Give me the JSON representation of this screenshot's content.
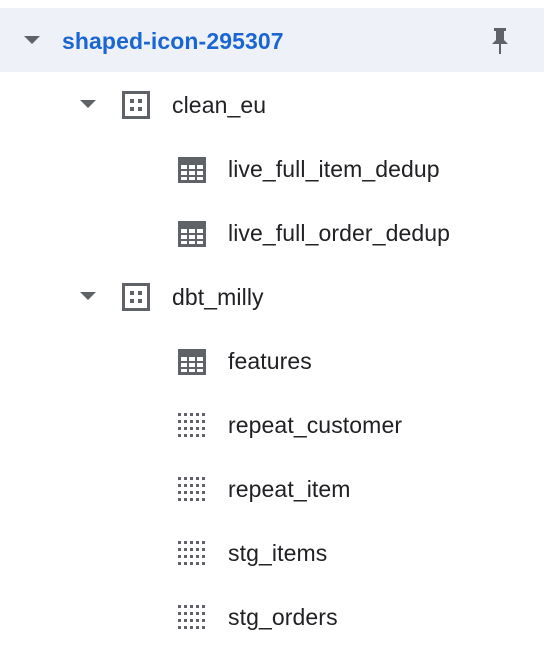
{
  "project": {
    "name": "shaped-icon-295307",
    "pin_icon": "pin-icon",
    "accent_color": "#1a66d2",
    "expanded": true
  },
  "datasets": [
    {
      "name": "clean_eu",
      "icon": "dataset-icon",
      "expanded": true,
      "items": [
        {
          "name": "live_full_item_dedup",
          "icon": "table-icon"
        },
        {
          "name": "live_full_order_dedup",
          "icon": "table-icon"
        }
      ]
    },
    {
      "name": "dbt_milly",
      "icon": "dataset-icon",
      "expanded": true,
      "items": [
        {
          "name": "features",
          "icon": "table-icon"
        },
        {
          "name": "repeat_customer",
          "icon": "view-icon"
        },
        {
          "name": "repeat_item",
          "icon": "view-icon"
        },
        {
          "name": "stg_items",
          "icon": "view-icon"
        },
        {
          "name": "stg_orders",
          "icon": "view-icon"
        }
      ]
    }
  ]
}
